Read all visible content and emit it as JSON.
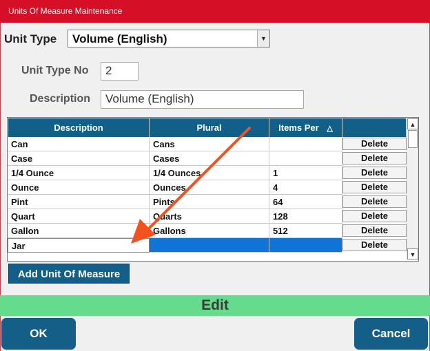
{
  "window": {
    "title": "Units Of Measure Maintenance"
  },
  "unit_type": {
    "label": "Unit Type",
    "selected": "Volume (English)",
    "dropdown_glyph": "▼"
  },
  "unit_type_no": {
    "label": "Unit Type No",
    "value": "2"
  },
  "description": {
    "label": "Description",
    "value": "Volume (English)"
  },
  "grid": {
    "columns": [
      "Description",
      "Plural",
      "Items Per",
      ""
    ],
    "sort_indicator": "△",
    "rows": [
      {
        "description": "Can",
        "plural": "Cans",
        "items_per": "",
        "action": "Delete"
      },
      {
        "description": "Case",
        "plural": "Cases",
        "items_per": "",
        "action": "Delete"
      },
      {
        "description": "1/4 Ounce",
        "plural": "1/4 Ounces",
        "items_per": "1",
        "action": "Delete"
      },
      {
        "description": "Ounce",
        "plural": "Ounces",
        "items_per": "4",
        "action": "Delete"
      },
      {
        "description": "Pint",
        "plural": "Pints",
        "items_per": "64",
        "action": "Delete"
      },
      {
        "description": "Quart",
        "plural": "Quarts",
        "items_per": "128",
        "action": "Delete"
      },
      {
        "description": "Gallon",
        "plural": "Gallons",
        "items_per": "512",
        "action": "Delete"
      },
      {
        "description": "Jar",
        "plural": "",
        "items_per": "",
        "action": "Delete"
      }
    ],
    "scroll_up": "▲",
    "scroll_down": "▼"
  },
  "add_button": "Add Unit Of Measure",
  "mode": "Edit",
  "ok_button": "OK",
  "cancel_button": "Cancel",
  "colors": {
    "title_bar": "#d40f26",
    "header": "#125f8a",
    "selection": "#0e74d8",
    "mode_bar": "#65dc8b",
    "annotation_arrow": "#f4511e"
  }
}
